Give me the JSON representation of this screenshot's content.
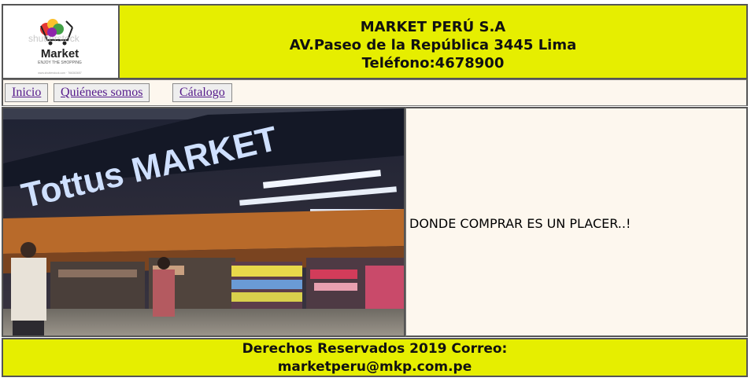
{
  "header": {
    "company": "MARKET PERÚ S.A",
    "address": "AV.Paseo de la República 3445 Lima",
    "phone": "Teléfono:4678900"
  },
  "logo": {
    "watermark": "shutterstock",
    "name": "Market",
    "tagline": "ENJOY THE SHOPPING",
    "url": "www.shutterstock.com · 766363657"
  },
  "nav": {
    "items": [
      {
        "label": "Inicio"
      },
      {
        "label": "Quiénees somos"
      },
      {
        "label": "Cátalogo"
      }
    ]
  },
  "photo": {
    "sign": "Tottus MARKET"
  },
  "main": {
    "slogan": "DONDE COMPRAR ES UN PLACER..!"
  },
  "footer": {
    "line1": "Derechos Reservados 2019 Correo:",
    "line2": "marketperu@mkp.com.pe"
  },
  "colors": {
    "header_bg": "#e6ee00",
    "nav_bg": "#fdf7ee",
    "link": "#551a8b"
  }
}
